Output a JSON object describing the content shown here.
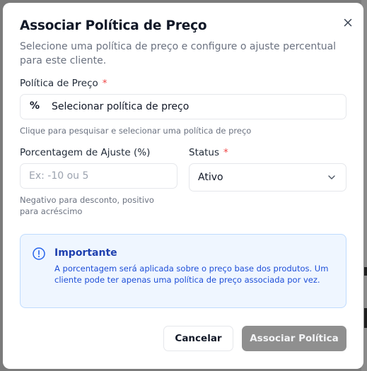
{
  "dialog": {
    "title": "Associar Política de Preço",
    "subtitle": "Selecione uma política de preço e configure o ajuste percentual para este cliente.",
    "close_icon": "close-icon"
  },
  "policy": {
    "label": "Política de Preço",
    "required_mark": "*",
    "icon_glyph": "%",
    "value": "Selecionar política de preço",
    "helper": "Clique para pesquisar e selecionar uma política de preço"
  },
  "adjustment": {
    "label": "Porcentagem de Ajuste (%)",
    "placeholder": "Ex: -10 ou 5",
    "helper": "Negativo para desconto, positivo para acréscimo"
  },
  "status": {
    "label": "Status",
    "required_mark": "*",
    "value": "Ativo",
    "icon": "chevron-down-icon"
  },
  "notice": {
    "icon": "info-icon",
    "title": "Importante",
    "text": "A porcentagem será aplicada sobre o preço base dos produtos. Um cliente pode ter apenas uma política de preço associada por vez."
  },
  "actions": {
    "cancel_label": "Cancelar",
    "submit_label": "Associar Política"
  },
  "colors": {
    "required": "#ef4444",
    "notice_background": "#eff6ff",
    "notice_border": "#bfdbfe",
    "notice_text": "#1d4ed8",
    "submit_disabled": "#8f8f8f"
  }
}
